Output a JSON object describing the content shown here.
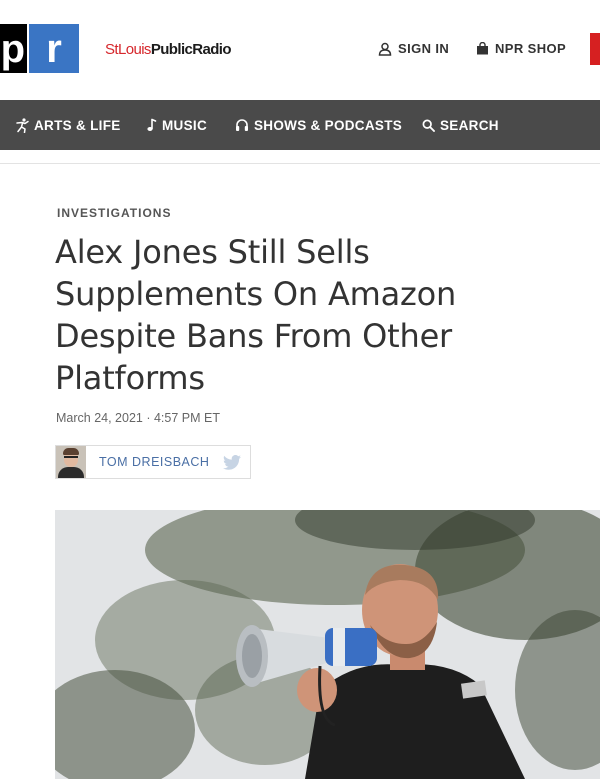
{
  "header": {
    "logo_letters": [
      "p",
      "r"
    ],
    "station_name_part1": "StLouis",
    "station_name_part2": "PublicRadio",
    "sign_in_label": "SIGN IN",
    "shop_label": "NPR SHOP",
    "colors": {
      "npr_black": "#000000",
      "npr_blue": "#3a75c4",
      "station_red": "#d6272c",
      "cta_red": "#d62021"
    },
    "icons": {
      "sign_in": "person-icon",
      "shop": "shopping-bag-icon"
    }
  },
  "nav": {
    "background": "#4a4a4a",
    "items": [
      {
        "label": "ARTS & LIFE",
        "icon": "dancer-icon"
      },
      {
        "label": "MUSIC",
        "icon": "music-note-icon"
      },
      {
        "label": "SHOWS & PODCASTS",
        "icon": "headphones-icon"
      },
      {
        "label": "SEARCH",
        "icon": "search-icon"
      }
    ]
  },
  "article": {
    "slug": "INVESTIGATIONS",
    "headline": "Alex Jones Still Sells Supplements On Amazon Despite Bans From Other Platforms",
    "dateline": "March 24, 2021 · 4:57 PM ET",
    "author": "TOM DREISBACH",
    "author_social_icon": "twitter-icon",
    "photo_icon": "lead-photo"
  }
}
